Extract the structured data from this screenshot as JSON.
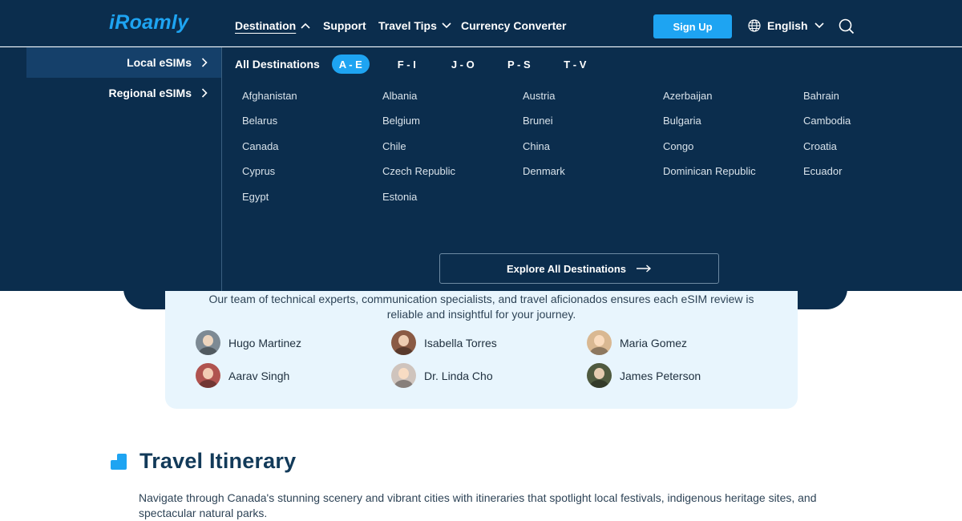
{
  "header": {
    "logo": "iRoamly",
    "nav": [
      {
        "label": "Destination"
      },
      {
        "label": "Support"
      },
      {
        "label": "Travel Tips"
      },
      {
        "label": "Currency Converter"
      }
    ],
    "signup_label": "Sign Up",
    "language": "English"
  },
  "mega_menu": {
    "side_items": [
      {
        "label": "Local eSIMs"
      },
      {
        "label": "Regional eSIMs"
      }
    ],
    "all_label": "All Destinations",
    "tabs": [
      {
        "label": "A - E"
      },
      {
        "label": "F - I"
      },
      {
        "label": "J - O"
      },
      {
        "label": "P - S"
      },
      {
        "label": "T - V"
      }
    ],
    "countries": [
      "Afghanistan",
      "Albania",
      "Austria",
      "Azerbaijan",
      "Bahrain",
      "Belarus",
      "Belgium",
      "Brunei",
      "Bulgaria",
      "Cambodia",
      "Canada",
      "Chile",
      "China",
      "Congo",
      "Croatia",
      "Cyprus",
      "Czech Republic",
      "Denmark",
      "Dominican Republic",
      "Ecuador",
      "Egypt",
      "Estonia"
    ],
    "explore_label": "Explore All Destinations"
  },
  "reviewers": {
    "intro": "Our team of technical experts, communication specialists, and travel aficionados ensures each eSIM review is reliable and insightful for your journey.",
    "people": [
      {
        "name": "Hugo Martinez"
      },
      {
        "name": "Isabella Torres"
      },
      {
        "name": "Maria Gomez"
      },
      {
        "name": "Aarav Singh"
      },
      {
        "name": "Dr. Linda Cho"
      },
      {
        "name": "James Peterson"
      }
    ]
  },
  "itinerary": {
    "title": "Travel Itinerary",
    "description": "Navigate through Canada's stunning scenery and vibrant cities with itineraries that spotlight local festivals, indigenous heritage sites, and spectacular natural parks."
  },
  "colors": {
    "navy": "#0b2d4d",
    "accent": "#1ea4f2",
    "light_panel": "#e8f5fd"
  }
}
